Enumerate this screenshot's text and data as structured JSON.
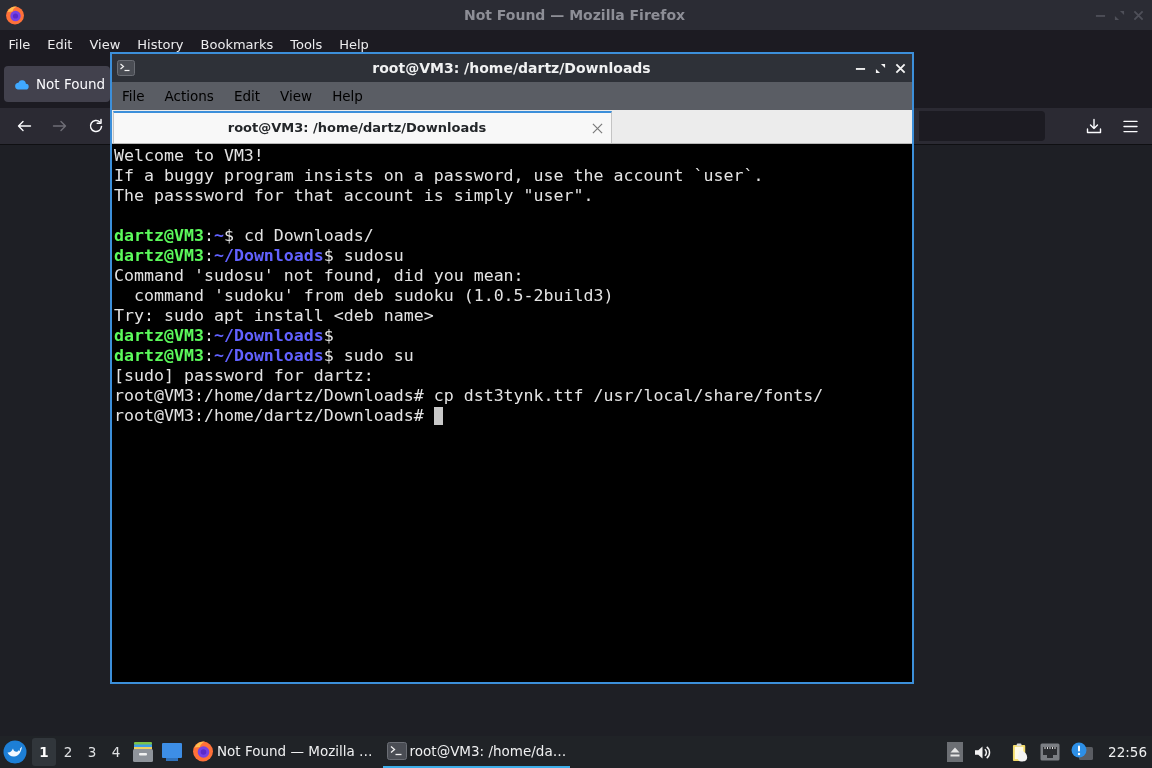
{
  "firefox": {
    "title": "Not Found — Mozilla Firefox",
    "menu": [
      "File",
      "Edit",
      "View",
      "History",
      "Bookmarks",
      "Tools",
      "Help"
    ],
    "tabs": [
      {
        "label": "Not Found",
        "selected": true
      }
    ],
    "nav_buttons": [
      {
        "kind": "back",
        "disabled": false
      },
      {
        "kind": "forward",
        "disabled": true
      },
      {
        "kind": "reload",
        "disabled": false
      }
    ]
  },
  "terminal": {
    "title": "root@VM3: /home/dartz/Downloads",
    "menu": [
      "File",
      "Actions",
      "Edit",
      "View",
      "Help"
    ],
    "tabs": [
      {
        "label": "root@VM3: /home/dartz/Downloads",
        "selected": true
      }
    ],
    "cursor_visible": true,
    "blocks": [
      {
        "lines": [
          {
            "segments": [
              {
                "kind": "plain",
                "text": "Welcome to VM3!"
              }
            ]
          },
          {
            "segments": [
              {
                "kind": "plain",
                "text": "If a buggy program insists on a password, use the account `user`."
              }
            ]
          },
          {
            "segments": [
              {
                "kind": "plain",
                "text": "The passsword for that account is simply \"user\"."
              }
            ]
          }
        ]
      },
      {
        "lines": [
          {
            "segments": [
              {
                "kind": "user",
                "text": "dartz@VM3"
              },
              {
                "kind": "plain",
                "text": ":"
              },
              {
                "kind": "path",
                "text": "~"
              },
              {
                "kind": "plain",
                "text": "$ cd Downloads/"
              }
            ]
          },
          {
            "segments": [
              {
                "kind": "user",
                "text": "dartz@VM3"
              },
              {
                "kind": "plain",
                "text": ":"
              },
              {
                "kind": "path",
                "text": "~/Downloads"
              },
              {
                "kind": "plain",
                "text": "$ sudosu"
              }
            ]
          },
          {
            "segments": [
              {
                "kind": "plain",
                "text": "Command 'sudosu' not found, did you mean:"
              }
            ]
          },
          {
            "segments": [
              {
                "kind": "plain",
                "text": "  command 'sudoku' from deb sudoku (1.0.5-2build3)"
              }
            ]
          },
          {
            "segments": [
              {
                "kind": "plain",
                "text": "Try: sudo apt install <deb name>"
              }
            ]
          },
          {
            "segments": [
              {
                "kind": "user",
                "text": "dartz@VM3"
              },
              {
                "kind": "plain",
                "text": ":"
              },
              {
                "kind": "path",
                "text": "~/Downloads"
              },
              {
                "kind": "plain",
                "text": "$"
              }
            ]
          },
          {
            "segments": [
              {
                "kind": "user",
                "text": "dartz@VM3"
              },
              {
                "kind": "plain",
                "text": ":"
              },
              {
                "kind": "path",
                "text": "~/Downloads"
              },
              {
                "kind": "plain",
                "text": "$ sudo su"
              }
            ]
          },
          {
            "segments": [
              {
                "kind": "plain",
                "text": "[sudo] password for dartz:"
              }
            ]
          },
          {
            "segments": [
              {
                "kind": "plain",
                "text": "root@VM3:/home/dartz/Downloads# cp dst3tynk.ttf /usr/local/share/fonts/"
              }
            ]
          },
          {
            "segments": [
              {
                "kind": "plain",
                "text": "root@VM3:/home/dartz/Downloads#"
              }
            ]
          }
        ]
      }
    ]
  },
  "taskbar": {
    "desktops": [
      {
        "label": "1",
        "selected": true
      },
      {
        "label": "2",
        "selected": false
      },
      {
        "label": "3",
        "selected": false
      },
      {
        "label": "4",
        "selected": false
      }
    ],
    "tasks": [
      {
        "kind": "browser",
        "label": "Not Found — Mozilla …",
        "selected": false
      },
      {
        "kind": "terminal",
        "label": "root@VM3: /home/da…",
        "selected": true
      }
    ],
    "clock": "22:56"
  }
}
